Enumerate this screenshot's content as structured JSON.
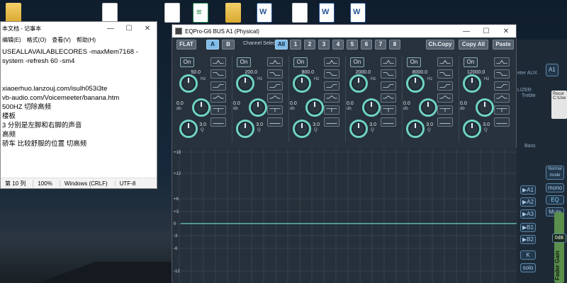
{
  "desktop": {
    "icons": [
      {
        "type": "folder"
      },
      {
        "type": "doc"
      },
      {
        "type": "doc"
      },
      {
        "type": "sheet"
      },
      {
        "type": "folder"
      },
      {
        "type": "word"
      },
      {
        "type": "doc"
      },
      {
        "type": "word"
      },
      {
        "type": "word"
      }
    ]
  },
  "notepad": {
    "title": "本文档 - 记事本",
    "menu": [
      "编辑(E)",
      "格式(O)",
      "查看(V)",
      "帮助(H)"
    ],
    "lines": [
      "USEALLAVAILABLECORES -maxMem7168 -",
      "system -refresh 60 -sm4",
      "",
      "",
      "xiaoerhuo.lanzouj.com/isulh053i3te",
      "vb-audio.com/Voicemeeter/banana.htm",
      " 500HZ 切除高频",
      "楼板",
      "3 分别是左脚和右脚的声音",
      "高频",
      "骄车 比较舒服的位置 切高频"
    ],
    "status": {
      "position": "第 10 列",
      "zoom": "100%",
      "line_ending": "Windows (CRLF)",
      "encoding": "UTF-8"
    },
    "controls": {
      "minimize": "—",
      "maximize": "☐",
      "close": "✕"
    }
  },
  "eq_window": {
    "title": "EQPro-G6 BUS A1 (Physical)",
    "controls": {
      "minimize": "—",
      "maximize": "☐",
      "close": "✕"
    },
    "toolbar": {
      "flat": "FLAT",
      "a": "A",
      "b": "B",
      "channel_select_label": "Channel Select:",
      "channels": [
        "All",
        "1",
        "2",
        "3",
        "4",
        "5",
        "6",
        "7",
        "8"
      ],
      "ch_copy": "Ch.Copy",
      "copy_all": "Copy All",
      "paste": "Paste"
    },
    "bands": [
      {
        "on": "On",
        "freq": "50.0",
        "gain": "0.0",
        "q": "3.0"
      },
      {
        "on": "On",
        "freq": "200.0",
        "gain": "0.0",
        "q": "3.0"
      },
      {
        "on": "On",
        "freq": "800.0",
        "gain": "0.0",
        "q": "3.0"
      },
      {
        "on": "On",
        "freq": "2000.0",
        "gain": "0.0",
        "q": "3.0"
      },
      {
        "on": "On",
        "freq": "8000.0",
        "gain": "0.0",
        "q": "3.0"
      },
      {
        "on": "On",
        "freq": "12000.0",
        "gain": "0.0",
        "q": "3.0"
      }
    ],
    "units": {
      "freq": "Hz",
      "gain": "db",
      "q": "Q"
    },
    "plot_labels": [
      "+18",
      "+12",
      "+6",
      "+3",
      "0",
      "-3",
      "-6",
      "-12"
    ]
  },
  "voicemeeter": {
    "labels": {
      "aux": "eter AUX",
      "treble": "Treble",
      "bass": "Bass",
      "lizer": "LIZER",
      "rec": "Recor",
      "c_use": "C:\\Use"
    },
    "buttons": {
      "a1": "A1",
      "normal_mode": "Normal mode",
      "mono": "mono",
      "eq": "EQ",
      "mute": "Mute",
      "ba1": "▶A1",
      "ba2": "▶A2",
      "ba3": "▶A3",
      "bb1": "▶B1",
      "bb2": "▶B2",
      "k": "K",
      "solo": "solo",
      "odb": "0dB"
    },
    "fader_label": "Fader Gain",
    "colors": {
      "accent": "#6fd3c3",
      "fader": "#5a8f4d"
    }
  }
}
